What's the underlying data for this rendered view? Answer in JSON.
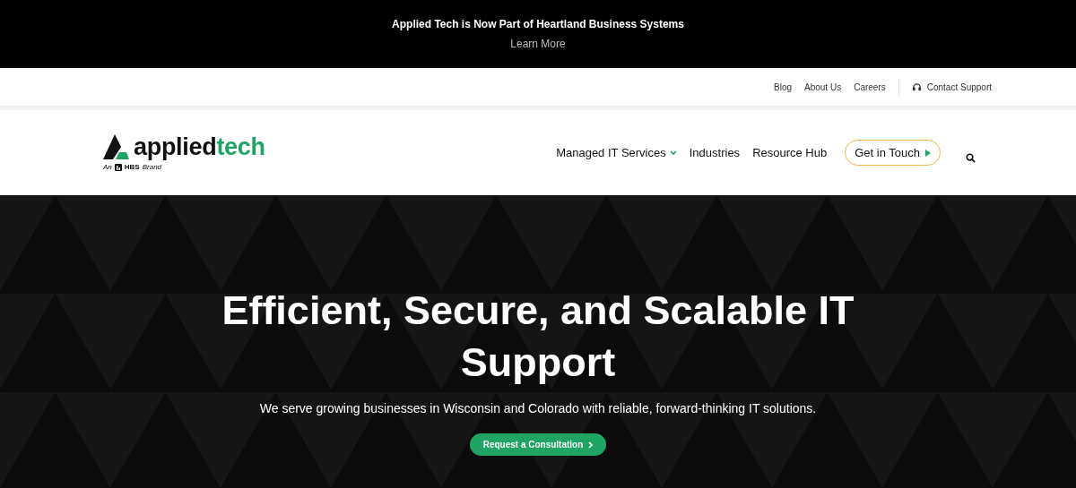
{
  "announcement": {
    "title": "Applied Tech is Now Part of Heartland Business Systems",
    "link": "Learn More"
  },
  "utility_nav": {
    "links": [
      "Blog",
      "About Us",
      "Careers"
    ],
    "support": "Contact Support"
  },
  "header": {
    "logo": {
      "primary": "applied",
      "secondary": "tech",
      "tagline_prefix": "An",
      "tagline_brand": "HBS",
      "tagline_suffix": "Brand"
    },
    "nav": [
      {
        "label": "Managed IT Services",
        "has_dropdown": true
      },
      {
        "label": "Industries",
        "has_dropdown": false
      },
      {
        "label": "Resource Hub",
        "has_dropdown": false
      }
    ],
    "cta": "Get in Touch"
  },
  "hero": {
    "title": "Efficient, Secure, and Scalable IT Support",
    "subtitle": "We serve growing businesses in Wisconsin and Colorado with reliable, forward-thinking IT solutions.",
    "button": "Request a Consultation"
  }
}
